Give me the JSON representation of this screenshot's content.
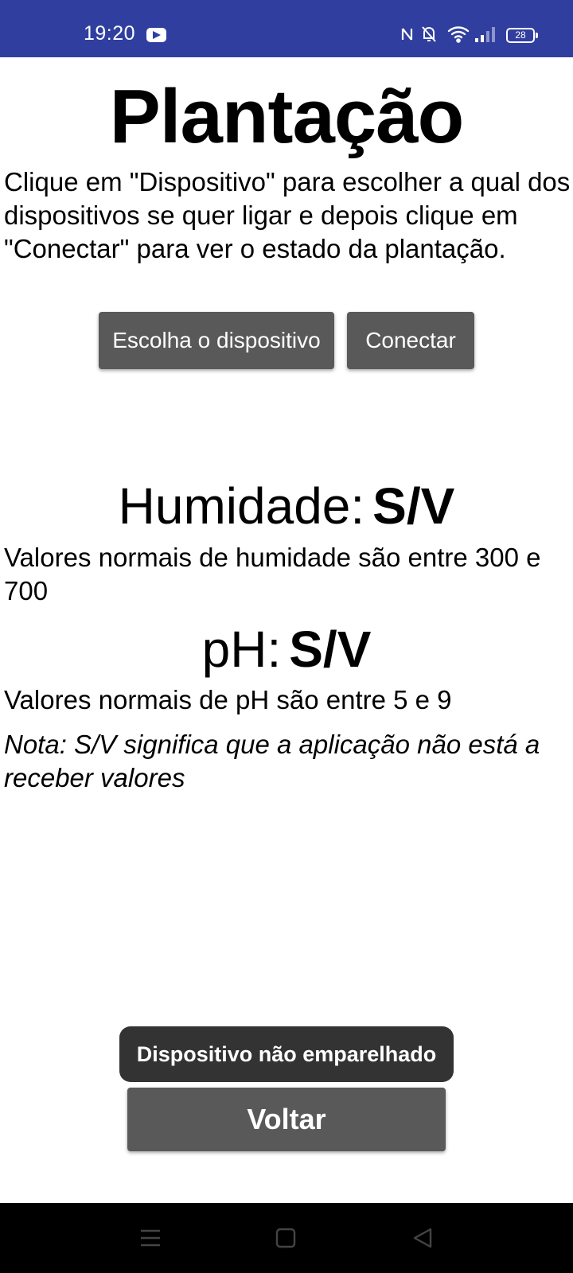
{
  "status_bar": {
    "time": "19:20",
    "battery": "28",
    "background_color": "#303f9f",
    "icons": [
      "youtube-icon",
      "nfc-icon",
      "bell-off-icon",
      "wifi-icon",
      "signal-icon",
      "battery-icon"
    ]
  },
  "app": {
    "title": "Plantação",
    "instructions": "Clique em \"Dispositivo\" para escolher a qual dos dispositivos se quer ligar e depois clique em \"Conectar\" para ver o estado da plantação.",
    "buttons": {
      "choose_device": "Escolha o dispositivo",
      "connect": "Conectar",
      "back": "Voltar"
    },
    "button_color": "#595959",
    "humidity": {
      "label": "Humidade:",
      "value": "S/V",
      "note": "Valores normais de humidade são entre 300 e 700"
    },
    "ph": {
      "label": "pH:",
      "value": "S/V",
      "note": "Valores normais de pH são entre 5 e 9"
    },
    "disclaimer": "Nota: S/V significa que a aplicação não está a receber valores"
  },
  "toast": {
    "message": "Dispositivo não emparelhado"
  },
  "nav_bar": {
    "icons": [
      "menu-icon",
      "home-icon",
      "back-icon"
    ]
  }
}
